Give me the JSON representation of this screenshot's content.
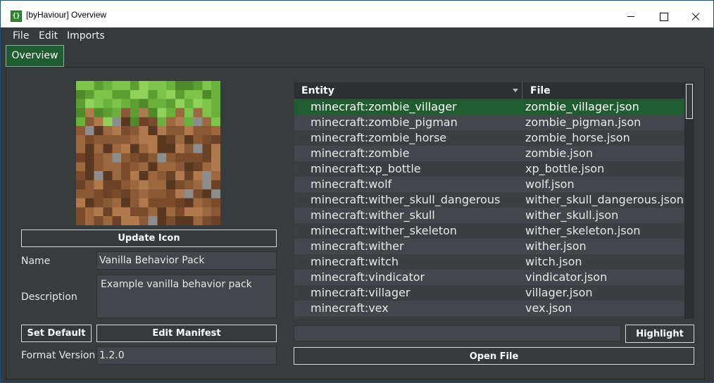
{
  "window": {
    "title": "[byHaviour] Overview",
    "icon_glyph": "{}",
    "controls": [
      "minimize-icon",
      "maximize-icon",
      "close-icon"
    ]
  },
  "menu": [
    "File",
    "Edit",
    "Imports"
  ],
  "tabs": [
    {
      "label": "Overview",
      "active": true
    }
  ],
  "pack": {
    "icon": "grass-block-icon",
    "update_icon_label": "Update Icon",
    "name_label": "Name",
    "name_value": "Vanilla Behavior Pack",
    "description_label": "Description",
    "description_value": "Example vanilla behavior pack",
    "set_default_label": "Set Default",
    "edit_manifest_label": "Edit Manifest",
    "format_version_label": "Format Version",
    "format_version_value": "1.2.0"
  },
  "entities": {
    "columns": [
      "Entity",
      "File"
    ],
    "sorted_column": "Entity",
    "selected_index": 0,
    "rows": [
      [
        "minecraft:zombie_villager",
        "zombie_villager.json"
      ],
      [
        "minecraft:zombie_pigman",
        "zombie_pigman.json"
      ],
      [
        "minecraft:zombie_horse",
        "zombie_horse.json"
      ],
      [
        "minecraft:zombie",
        "zombie.json"
      ],
      [
        "minecraft:xp_bottle",
        "xp_bottle.json"
      ],
      [
        "minecraft:wolf",
        "wolf.json"
      ],
      [
        "minecraft:wither_skull_dangerous",
        "wither_skull_dangerous.json"
      ],
      [
        "minecraft:wither_skull",
        "wither_skull.json"
      ],
      [
        "minecraft:wither_skeleton",
        "wither_skeleton.json"
      ],
      [
        "minecraft:wither",
        "wither.json"
      ],
      [
        "minecraft:witch",
        "witch.json"
      ],
      [
        "minecraft:vindicator",
        "vindicator.json"
      ],
      [
        "minecraft:villager",
        "villager.json"
      ],
      [
        "minecraft:vex",
        "vex.json"
      ]
    ],
    "search_value": "",
    "highlight_label": "Highlight",
    "open_file_label": "Open File"
  },
  "colors": {
    "accent_green": "#1f5c2f",
    "background": "#373c3f",
    "field": "#41474a"
  }
}
